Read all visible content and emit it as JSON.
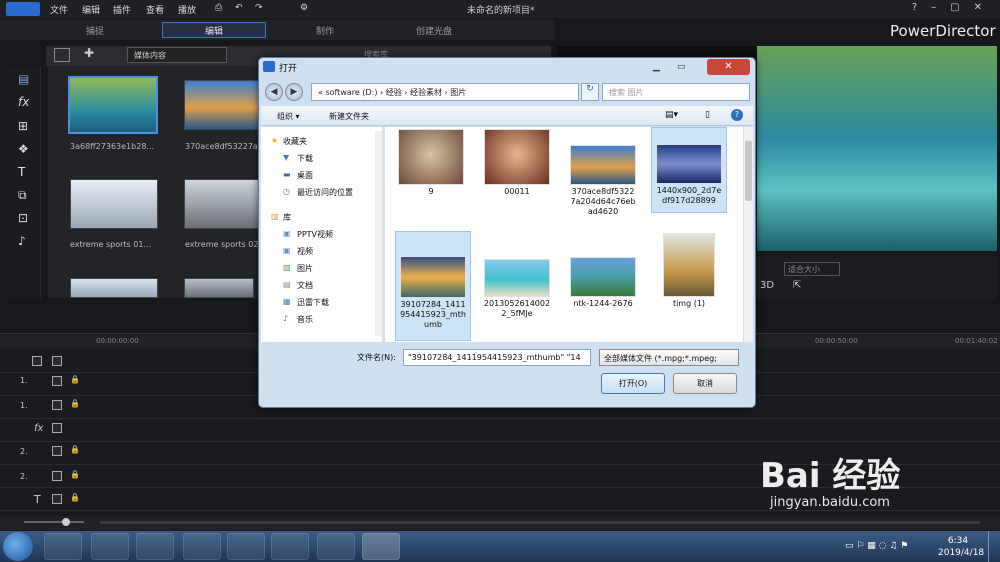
{
  "app": {
    "title": "未命名的新项目*",
    "brand": "PowerDirector",
    "menus": [
      "文件",
      "编辑",
      "插件",
      "查看",
      "播放"
    ],
    "modes": [
      "捕捉",
      "编辑",
      "制作",
      "创建光盘"
    ]
  },
  "library": {
    "dropdown": "媒体内容",
    "search_placeholder": "搜索库",
    "items": [
      "3a68ff27363e1b28...",
      "370ace8df53227a...",
      "extreme sports 01...",
      "extreme sports 02..."
    ]
  },
  "preview": {
    "fit_label": "适合大小",
    "mode_3d": "3D"
  },
  "timeline": {
    "ruler": [
      "00:00:00:00",
      "00:00:50:00",
      "00:01:40:02"
    ],
    "tracks": [
      "1.",
      "1.",
      "fx",
      "2.",
      "2.",
      "T"
    ]
  },
  "dialog": {
    "title": "打开",
    "breadcrumb": "« software (D:) › 经验 › 经验素材 › 图片",
    "search_placeholder": "搜索 图片",
    "organize": "组织 ▾",
    "new_folder": "新建文件夹",
    "nav_favorites": "收藏夹",
    "nav_items_fav": [
      "下载",
      "桌面",
      "最近访问的位置"
    ],
    "nav_library": "库",
    "nav_items_lib": [
      "PPTV视频",
      "视频",
      "图片",
      "文档",
      "迅雷下载",
      "音乐"
    ],
    "files": [
      {
        "name": "9"
      },
      {
        "name": "00011"
      },
      {
        "name": "370ace8df5322\n7a204d64c76eb\nad4620"
      },
      {
        "name": "1440x900_2d7e\ndf917d28899"
      },
      {
        "name": "39107284_1411\n954415923_mth\numb"
      },
      {
        "name": "2013052614002\n2_5fMJe"
      },
      {
        "name": "ntk-1244-2676"
      },
      {
        "name": "timg (1)"
      }
    ],
    "filename_label": "文件名(N):",
    "filename_value": "\"39107284_1411954415923_mthumb\" \"14",
    "filetype_value": "全部媒体文件 (*.mpg;*.mpeg;",
    "open_button": "打开(O)",
    "cancel_button": "取消"
  },
  "taskbar": {
    "time": "6:34",
    "date": "2019/4/18"
  },
  "watermark": {
    "text": "Bai 经验",
    "url": "jingyan.baidu.com"
  },
  "colors": {
    "accent": "#3a74c8",
    "dialog_chrome": "#cfe0f1",
    "selection": "#cce4f7",
    "close_red": "#c9463d"
  }
}
